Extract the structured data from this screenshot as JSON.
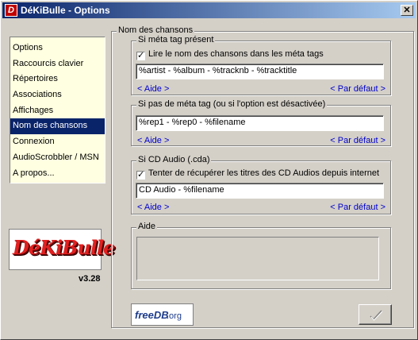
{
  "window": {
    "title": "DéKiBulle - Options",
    "close_glyph": "✕",
    "app_icon": "D"
  },
  "nav": {
    "items": [
      {
        "label": "Options"
      },
      {
        "label": "Raccourcis clavier"
      },
      {
        "label": "Répertoires"
      },
      {
        "label": "Associations"
      },
      {
        "label": "Affichages"
      },
      {
        "label": "Nom des chansons",
        "selected": true
      },
      {
        "label": "Connexion"
      },
      {
        "label": "AudioScrobbler / MSN"
      },
      {
        "label": "A propos..."
      }
    ]
  },
  "logo": {
    "text": "DéKiBulle"
  },
  "version": "v3.28",
  "main": {
    "frame_title": "Nom des chansons",
    "meta": {
      "title": "Si méta tag présent",
      "checkbox_label": "Lire le nom des chansons dans les méta tags",
      "checkbox_checked": true,
      "value": "%artist - %album - %tracknb - %tracktitle",
      "help": "< Aide >",
      "default": "< Par défaut >"
    },
    "nometa": {
      "title": "Si pas de méta tag (ou si l'option est désactivée)",
      "value": "%rep1 - %rep0 - %filename",
      "help": "< Aide >",
      "default": "< Par défaut >"
    },
    "cda": {
      "title": "Si CD Audio (.cda)",
      "checkbox_label": "Tenter de récupérer les titres des CD Audios depuis internet",
      "checkbox_checked": true,
      "value": "CD Audio - %filename",
      "help": "< Aide >",
      "default": "< Par défaut >"
    },
    "aide": {
      "title": "Aide"
    }
  },
  "freedb": {
    "part1": "freeDB",
    "part2": ".org"
  },
  "check_glyph": "✓"
}
